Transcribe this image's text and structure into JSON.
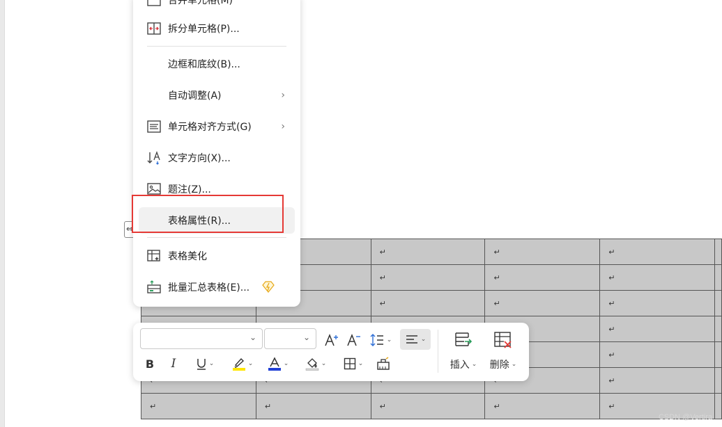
{
  "context_menu": {
    "items": [
      {
        "label": "合并单元格(M)"
      },
      {
        "label": "拆分单元格(P)..."
      },
      {
        "label": "边框和底纹(B)..."
      },
      {
        "label": "自动调整(A)"
      },
      {
        "label": "单元格对齐方式(G)"
      },
      {
        "label": "文字方向(X)..."
      },
      {
        "label": "题注(Z)..."
      },
      {
        "label": "表格属性(R)..."
      },
      {
        "label": "表格美化"
      },
      {
        "label": "批量汇总表格(E)..."
      }
    ],
    "submenu_arrow": "›"
  },
  "table": {
    "paragraph_mark": "↵",
    "rows": 7,
    "cols": 6
  },
  "toolbar": {
    "font_name": "",
    "font_size": "",
    "insert_label": "插入",
    "delete_label": "删除",
    "dropdown_caret": "⌄"
  },
  "colors": {
    "highlight": "#ffe600",
    "font_color": "#1f3fd6",
    "callout_box": "#e53935"
  },
  "watermark": "CSDN @Vertira"
}
